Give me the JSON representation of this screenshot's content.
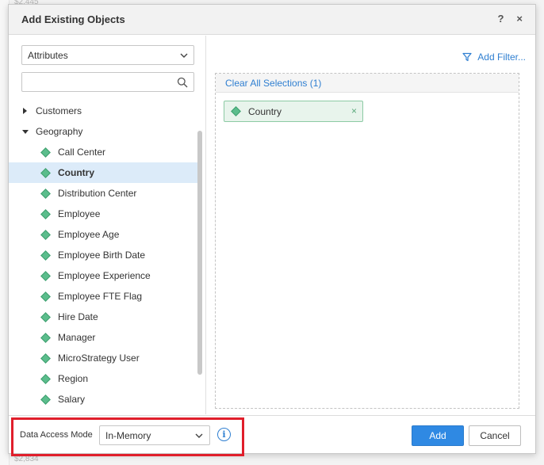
{
  "background": {
    "top_value": "$2,445",
    "bottom_value": "$2,834"
  },
  "dialog": {
    "title": "Add Existing Objects",
    "help_label": "?",
    "close_label": "×"
  },
  "left_pane": {
    "object_type": "Attributes",
    "search": {
      "value": "",
      "placeholder": ""
    },
    "tree": {
      "groups": [
        {
          "label": "Customers",
          "expanded": false
        },
        {
          "label": "Geography",
          "expanded": true
        }
      ],
      "items": [
        {
          "label": "Call Center"
        },
        {
          "label": "Country",
          "selected": true
        },
        {
          "label": "Distribution Center"
        },
        {
          "label": "Employee"
        },
        {
          "label": "Employee Age"
        },
        {
          "label": "Employee Birth Date"
        },
        {
          "label": "Employee Experience"
        },
        {
          "label": "Employee FTE Flag"
        },
        {
          "label": "Hire Date"
        },
        {
          "label": "Manager"
        },
        {
          "label": "MicroStrategy User"
        },
        {
          "label": "Region"
        },
        {
          "label": "Salary"
        }
      ]
    }
  },
  "right_pane": {
    "add_filter_label": "Add Filter...",
    "clear_selections_label": "Clear All Selections (1)",
    "selected_chip": {
      "label": "Country",
      "remove_label": "×"
    }
  },
  "footer": {
    "data_access_label": "Data Access Mode",
    "data_access_value": "In-Memory",
    "info_label": "i",
    "add_label": "Add",
    "cancel_label": "Cancel"
  },
  "colors": {
    "accent": "#2f89e3",
    "link": "#2f7fd1",
    "attribute_icon": "#5bbd8c",
    "highlight_box": "#e01e2b",
    "selected_row": "#dcebf9"
  },
  "icons": {
    "dropdown": "chevron-down-icon",
    "search": "search-icon",
    "filter": "filter-icon",
    "attribute": "attribute-diamond-icon",
    "info": "info-icon"
  }
}
